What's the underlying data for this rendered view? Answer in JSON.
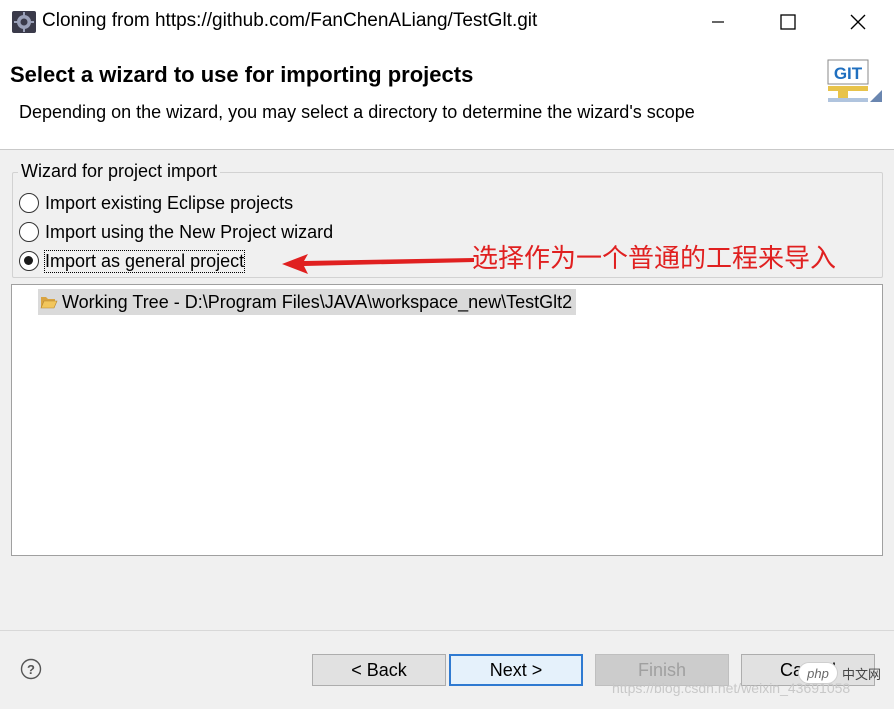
{
  "window": {
    "title": "Cloning from https://github.com/FanChenALiang/TestGlt.git",
    "minimize_icon": "minimize-icon",
    "maximize_icon": "maximize-icon",
    "close_icon": "close-icon"
  },
  "banner": {
    "title": "Select a wizard to use for importing projects",
    "description": "Depending on the wizard, you may select a directory to determine the wizard's scope",
    "logo_text": "GIT"
  },
  "wizard_group": {
    "label": "Wizard for project import",
    "options": [
      {
        "label": "Import existing Eclipse projects",
        "selected": false
      },
      {
        "label": "Import using the New Project wizard",
        "selected": false
      },
      {
        "label": "Import as general project",
        "selected": true
      }
    ]
  },
  "annotation": {
    "text": "选择作为一个普通的工程来导入",
    "color": "#e02020"
  },
  "tree": {
    "items": [
      {
        "label": "Working Tree - D:\\Program Files\\JAVA\\workspace_new\\TestGlt2",
        "icon": "folder-open-icon",
        "selected": true
      }
    ]
  },
  "footer": {
    "help_icon": "help-icon",
    "back_label": "< Back",
    "next_label": "Next >",
    "finish_label": "Finish",
    "cancel_label": "Cancel"
  },
  "watermark": {
    "badge": "php",
    "badge_cn": "中文网",
    "text": "https://blog.csdn.net/weixin_43691058"
  },
  "colors": {
    "accent": "#2f7ad1",
    "annotation": "#e02020",
    "selection": "#dadada"
  }
}
